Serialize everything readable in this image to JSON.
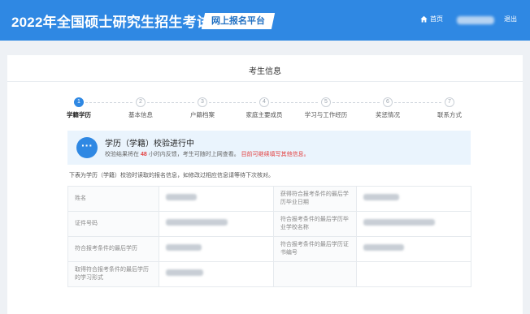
{
  "header": {
    "title": "2022年全国硕士研究生招生考试",
    "platform": "网上报名平台",
    "home": "首页",
    "logout": "退出"
  },
  "page": {
    "title": "考生信息"
  },
  "steps": [
    {
      "num": "1",
      "label": "学籍学历",
      "active": true
    },
    {
      "num": "2",
      "label": "基本信息",
      "active": false
    },
    {
      "num": "3",
      "label": "户籍档案",
      "active": false
    },
    {
      "num": "4",
      "label": "家庭主要成员",
      "active": false
    },
    {
      "num": "5",
      "label": "学习与工作经历",
      "active": false
    },
    {
      "num": "6",
      "label": "奖惩情况",
      "active": false
    },
    {
      "num": "7",
      "label": "联系方式",
      "active": false
    }
  ],
  "notice": {
    "title": "学历（学籍）校验进行中",
    "text_before": "校验结果将在",
    "hours": "48",
    "text_middle": "小时内反馈，考生可随时上网查看。",
    "warning": "目前可继续填写其他信息。"
  },
  "description": "下表为学历（学籍）校验时读取的报名信息，如修改过相应信息请等待下次核对。",
  "table": {
    "rows": [
      {
        "k1": "姓名",
        "k2": "获得符合报考条件的最后学历毕业日期"
      },
      {
        "k1": "证件号码",
        "k2": "符合报考条件的最后学历毕业学校名称"
      },
      {
        "k1": "符合报考条件的最后学历",
        "k2": "符合报考条件的最后学历证书编号"
      },
      {
        "k1": "取得符合报考条件的最后学历的学习形式",
        "k2": ""
      }
    ]
  },
  "colors": {
    "primary": "#2f88e3",
    "warning": "#e34040",
    "notice_bg": "#eaf4fd"
  },
  "icons": {
    "home": "home-icon",
    "notice": "more-dots-icon"
  }
}
